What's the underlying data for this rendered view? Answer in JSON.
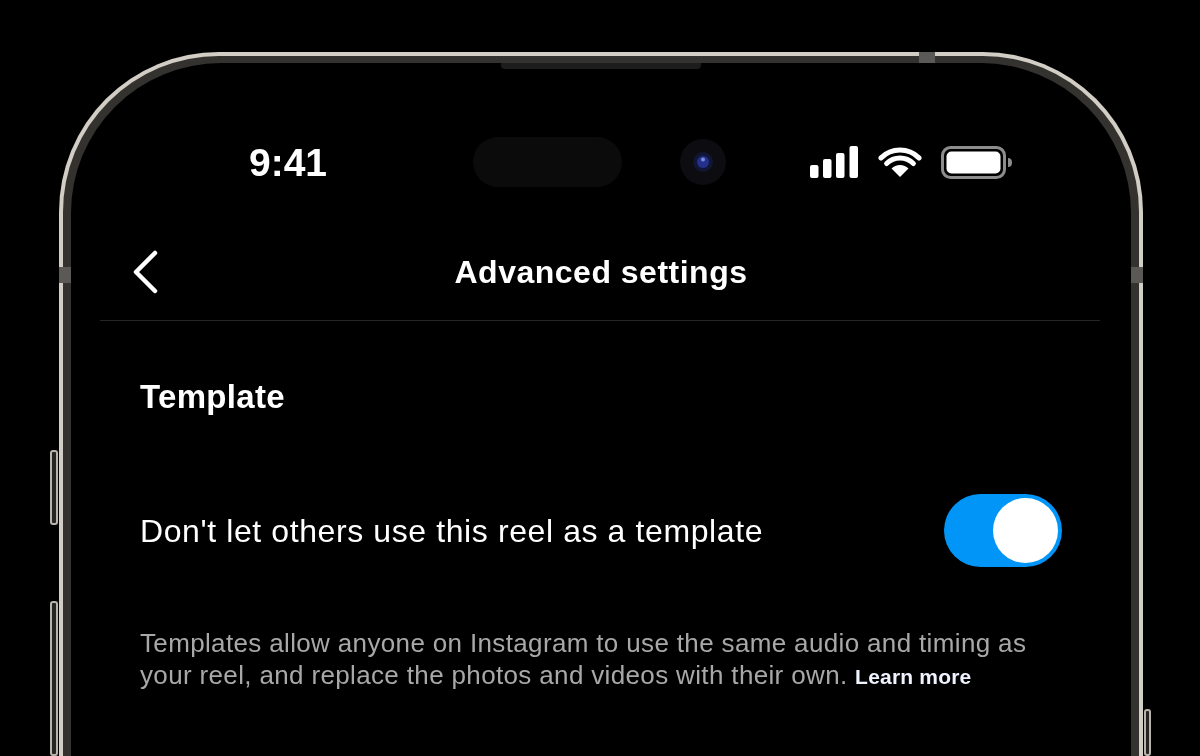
{
  "status_bar": {
    "time": "9:41"
  },
  "nav_bar": {
    "title": "Advanced settings"
  },
  "sections": [
    {
      "title": "Template",
      "settings": [
        {
          "label": "Don't let others use this reel as a template",
          "on": true
        }
      ],
      "description": {
        "text": "Templates allow anyone on Instagram to use the same audio and timing as your reel, and replace the photos and videos with their own.",
        "link": "Learn more"
      }
    }
  ]
}
